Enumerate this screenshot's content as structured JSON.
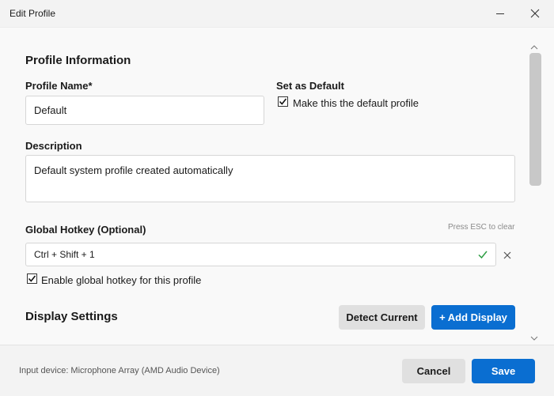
{
  "window": {
    "title": "Edit Profile"
  },
  "profile_info": {
    "section_title": "Profile Information",
    "name_label": "Profile Name*",
    "name_value": "Default",
    "default_label": "Set as Default",
    "default_checkbox_label": "Make this the default profile",
    "default_checked": true,
    "description_label": "Description",
    "description_value": "Default system profile created automatically"
  },
  "hotkey": {
    "label": "Global Hotkey (Optional)",
    "hint": "Press ESC to clear",
    "value": "Ctrl + Shift + 1",
    "enable_label": "Enable global hotkey for this profile",
    "enable_checked": true
  },
  "display_settings": {
    "section_title": "Display Settings",
    "detect_button": "Detect Current",
    "add_button": "+ Add Display"
  },
  "footer": {
    "status": "Input device: Microphone Array (AMD Audio Device)",
    "cancel_button": "Cancel",
    "save_button": "Save"
  },
  "colors": {
    "accent": "#0a6ed1",
    "valid": "#2e9e44"
  },
  "icons": [
    "minimize-icon",
    "close-icon",
    "checkmark-icon",
    "clear-icon",
    "scroll-up-icon",
    "scroll-down-icon"
  ]
}
